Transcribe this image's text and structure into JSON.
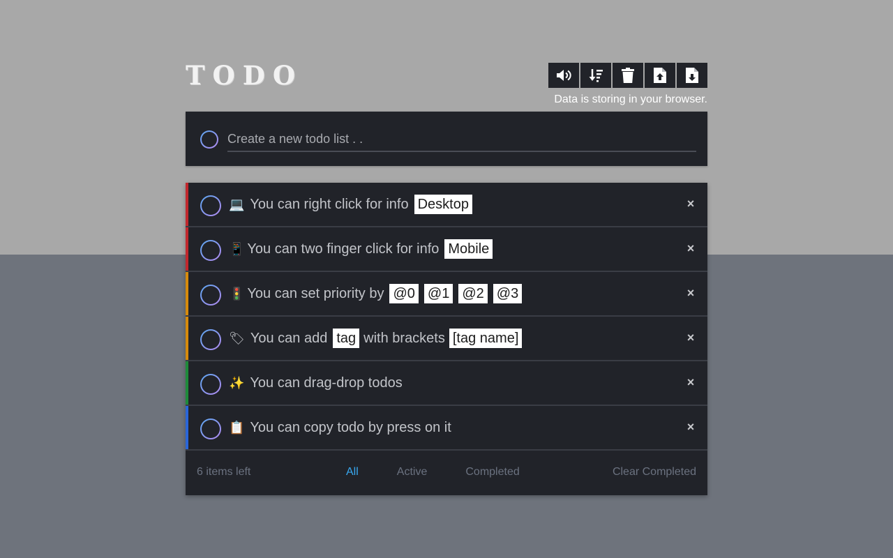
{
  "app": {
    "logo": "TODO",
    "storage_note": "Data is storing in your browser."
  },
  "toolbar": {
    "buttons": [
      {
        "icon": "volume-icon"
      },
      {
        "icon": "sort-icon"
      },
      {
        "icon": "trash-icon"
      },
      {
        "icon": "file-upload-icon"
      },
      {
        "icon": "file-download-icon"
      }
    ]
  },
  "new_todo": {
    "placeholder": "Create a new todo list . ."
  },
  "todos": [
    {
      "bar_color": "#c1272d",
      "emoji": "💻",
      "text": "You can right click for info",
      "tags": [
        "Desktop"
      ]
    },
    {
      "bar_color": "#c1272d",
      "emoji": "📱",
      "text": "You can two finger click for info",
      "tags": [
        "Mobile"
      ]
    },
    {
      "bar_color": "#d68a0c",
      "emoji": "🚦",
      "text": "You can set priority by",
      "tags": [
        "@0",
        "@1",
        "@2",
        "@3"
      ]
    },
    {
      "bar_color": "#d68a0c",
      "emoji": "🏷",
      "text_a": "You can add",
      "tag_a": "tag",
      "text_b": "with brackets",
      "tag_b": "[tag name]"
    },
    {
      "bar_color": "#1e8a3a",
      "emoji": "✨",
      "text": "You can drag-drop todos"
    },
    {
      "bar_color": "#2a66d8",
      "emoji": "📋",
      "text": "You can copy todo by press on it"
    }
  ],
  "delete_glyph": "×",
  "footer": {
    "items_left": "6 items left",
    "filter_all": "All",
    "filter_active": "Active",
    "filter_completed": "Completed",
    "clear_completed": "Clear Completed"
  },
  "colors": {
    "accent": "#38a8f0",
    "panel": "#212329",
    "bg_top": "#a8a8a8",
    "bg_bottom": "#6e737c"
  }
}
